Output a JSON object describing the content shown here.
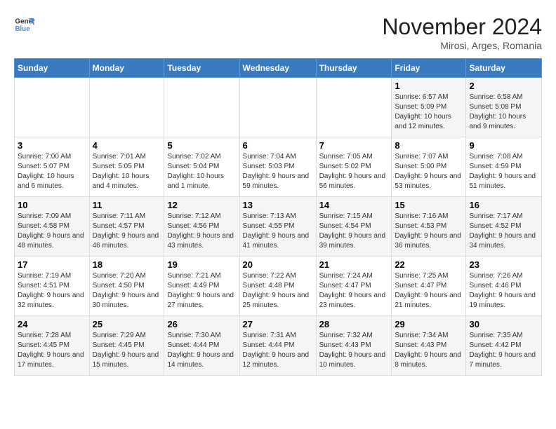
{
  "logo": {
    "line1": "General",
    "line2": "Blue"
  },
  "title": "November 2024",
  "location": "Mirosi, Arges, Romania",
  "weekdays": [
    "Sunday",
    "Monday",
    "Tuesday",
    "Wednesday",
    "Thursday",
    "Friday",
    "Saturday"
  ],
  "weeks": [
    [
      {
        "day": "",
        "info": ""
      },
      {
        "day": "",
        "info": ""
      },
      {
        "day": "",
        "info": ""
      },
      {
        "day": "",
        "info": ""
      },
      {
        "day": "",
        "info": ""
      },
      {
        "day": "1",
        "info": "Sunrise: 6:57 AM\nSunset: 5:09 PM\nDaylight: 10 hours and 12 minutes."
      },
      {
        "day": "2",
        "info": "Sunrise: 6:58 AM\nSunset: 5:08 PM\nDaylight: 10 hours and 9 minutes."
      }
    ],
    [
      {
        "day": "3",
        "info": "Sunrise: 7:00 AM\nSunset: 5:07 PM\nDaylight: 10 hours and 6 minutes."
      },
      {
        "day": "4",
        "info": "Sunrise: 7:01 AM\nSunset: 5:05 PM\nDaylight: 10 hours and 4 minutes."
      },
      {
        "day": "5",
        "info": "Sunrise: 7:02 AM\nSunset: 5:04 PM\nDaylight: 10 hours and 1 minute."
      },
      {
        "day": "6",
        "info": "Sunrise: 7:04 AM\nSunset: 5:03 PM\nDaylight: 9 hours and 59 minutes."
      },
      {
        "day": "7",
        "info": "Sunrise: 7:05 AM\nSunset: 5:02 PM\nDaylight: 9 hours and 56 minutes."
      },
      {
        "day": "8",
        "info": "Sunrise: 7:07 AM\nSunset: 5:00 PM\nDaylight: 9 hours and 53 minutes."
      },
      {
        "day": "9",
        "info": "Sunrise: 7:08 AM\nSunset: 4:59 PM\nDaylight: 9 hours and 51 minutes."
      }
    ],
    [
      {
        "day": "10",
        "info": "Sunrise: 7:09 AM\nSunset: 4:58 PM\nDaylight: 9 hours and 48 minutes."
      },
      {
        "day": "11",
        "info": "Sunrise: 7:11 AM\nSunset: 4:57 PM\nDaylight: 9 hours and 46 minutes."
      },
      {
        "day": "12",
        "info": "Sunrise: 7:12 AM\nSunset: 4:56 PM\nDaylight: 9 hours and 43 minutes."
      },
      {
        "day": "13",
        "info": "Sunrise: 7:13 AM\nSunset: 4:55 PM\nDaylight: 9 hours and 41 minutes."
      },
      {
        "day": "14",
        "info": "Sunrise: 7:15 AM\nSunset: 4:54 PM\nDaylight: 9 hours and 39 minutes."
      },
      {
        "day": "15",
        "info": "Sunrise: 7:16 AM\nSunset: 4:53 PM\nDaylight: 9 hours and 36 minutes."
      },
      {
        "day": "16",
        "info": "Sunrise: 7:17 AM\nSunset: 4:52 PM\nDaylight: 9 hours and 34 minutes."
      }
    ],
    [
      {
        "day": "17",
        "info": "Sunrise: 7:19 AM\nSunset: 4:51 PM\nDaylight: 9 hours and 32 minutes."
      },
      {
        "day": "18",
        "info": "Sunrise: 7:20 AM\nSunset: 4:50 PM\nDaylight: 9 hours and 30 minutes."
      },
      {
        "day": "19",
        "info": "Sunrise: 7:21 AM\nSunset: 4:49 PM\nDaylight: 9 hours and 27 minutes."
      },
      {
        "day": "20",
        "info": "Sunrise: 7:22 AM\nSunset: 4:48 PM\nDaylight: 9 hours and 25 minutes."
      },
      {
        "day": "21",
        "info": "Sunrise: 7:24 AM\nSunset: 4:47 PM\nDaylight: 9 hours and 23 minutes."
      },
      {
        "day": "22",
        "info": "Sunrise: 7:25 AM\nSunset: 4:47 PM\nDaylight: 9 hours and 21 minutes."
      },
      {
        "day": "23",
        "info": "Sunrise: 7:26 AM\nSunset: 4:46 PM\nDaylight: 9 hours and 19 minutes."
      }
    ],
    [
      {
        "day": "24",
        "info": "Sunrise: 7:28 AM\nSunset: 4:45 PM\nDaylight: 9 hours and 17 minutes."
      },
      {
        "day": "25",
        "info": "Sunrise: 7:29 AM\nSunset: 4:45 PM\nDaylight: 9 hours and 15 minutes."
      },
      {
        "day": "26",
        "info": "Sunrise: 7:30 AM\nSunset: 4:44 PM\nDaylight: 9 hours and 14 minutes."
      },
      {
        "day": "27",
        "info": "Sunrise: 7:31 AM\nSunset: 4:44 PM\nDaylight: 9 hours and 12 minutes."
      },
      {
        "day": "28",
        "info": "Sunrise: 7:32 AM\nSunset: 4:43 PM\nDaylight: 9 hours and 10 minutes."
      },
      {
        "day": "29",
        "info": "Sunrise: 7:34 AM\nSunset: 4:43 PM\nDaylight: 9 hours and 8 minutes."
      },
      {
        "day": "30",
        "info": "Sunrise: 7:35 AM\nSunset: 4:42 PM\nDaylight: 9 hours and 7 minutes."
      }
    ]
  ]
}
